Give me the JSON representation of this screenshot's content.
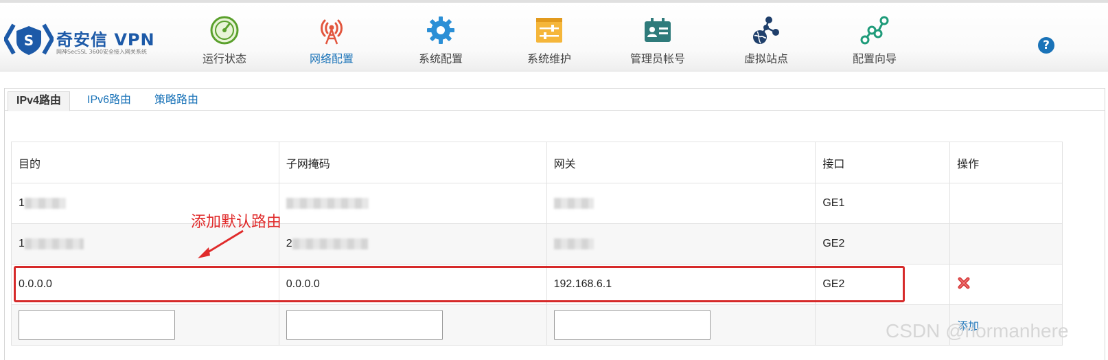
{
  "brand": {
    "name": "奇安信 VPN",
    "subtitle": "网神SecSSL 3600安全接入网关系统"
  },
  "nav": [
    {
      "label": "运行状态",
      "icon": "gauge-icon",
      "active": false
    },
    {
      "label": "网络配置",
      "icon": "antenna-tower-icon",
      "active": true
    },
    {
      "label": "系统配置",
      "icon": "gear-icon",
      "active": false
    },
    {
      "label": "系统维护",
      "icon": "sliders-panel-icon",
      "active": false
    },
    {
      "label": "管理员帐号",
      "icon": "id-card-icon",
      "active": false
    },
    {
      "label": "虚拟站点",
      "icon": "globe-network-icon",
      "active": false
    },
    {
      "label": "配置向导",
      "icon": "route-nodes-icon",
      "active": false
    }
  ],
  "tabs": [
    {
      "label": "IPv4路由",
      "active": true
    },
    {
      "label": "IPv6路由",
      "active": false
    },
    {
      "label": "策略路由",
      "active": false
    }
  ],
  "table": {
    "headers": [
      "目的",
      "子网掩码",
      "网关",
      "接口",
      "操作"
    ],
    "rows": [
      {
        "dest": "1",
        "mask": "",
        "gateway": "",
        "iface": "GE1",
        "redacted": true
      },
      {
        "dest": "1",
        "mask": "2",
        "gateway": "",
        "iface": "GE2",
        "redacted": true
      },
      {
        "dest": "0.0.0.0",
        "mask": "0.0.0.0",
        "gateway": "192.168.6.1",
        "iface": "GE2",
        "redacted": false
      }
    ],
    "add_label": "添加"
  },
  "annotation": {
    "text": "添加默认路由",
    "color": "#d62a2a"
  },
  "watermark": "CSDN @normanhere",
  "colors": {
    "accent": "#1a73b8",
    "brand": "#1d5aa8",
    "annotation": "#e02b2b"
  }
}
